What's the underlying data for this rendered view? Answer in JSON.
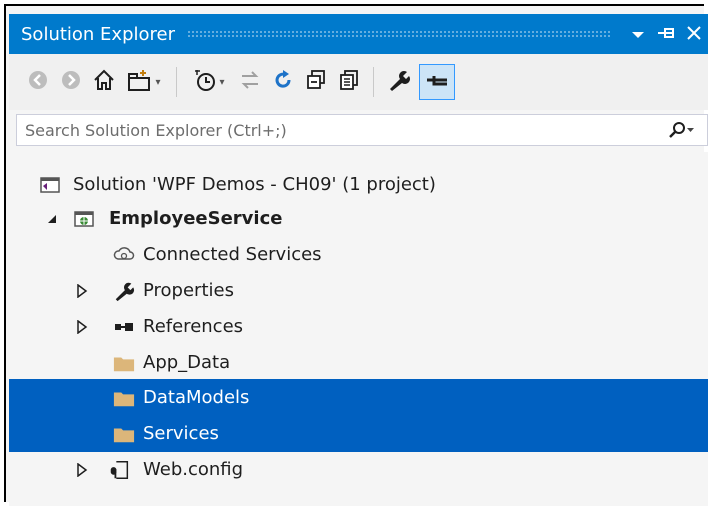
{
  "window": {
    "title": "Solution Explorer",
    "controls": {
      "dropdown": "▾",
      "pin": "⊣",
      "close": "✕"
    }
  },
  "toolbar": {
    "buttons": [
      "back-icon",
      "forward-icon",
      "home-icon",
      "switch-views-icon",
      "pending-changes-icon",
      "sync-icon",
      "refresh-icon",
      "collapse-all-icon",
      "show-all-files-icon",
      "properties-icon",
      "preview-selected-icon"
    ]
  },
  "search": {
    "placeholder": "Search Solution Explorer (Ctrl+;)"
  },
  "tree": {
    "solution": "Solution 'WPF Demos - CH09' (1 project)",
    "project": "EmployeeService",
    "items": [
      {
        "label": "Connected Services",
        "icon": "connected-services-icon"
      },
      {
        "label": "Properties",
        "icon": "wrench-icon"
      },
      {
        "label": "References",
        "icon": "references-icon"
      },
      {
        "label": "App_Data",
        "icon": "folder-icon"
      },
      {
        "label": "DataModels",
        "icon": "folder-icon",
        "selected": true
      },
      {
        "label": "Services",
        "icon": "folder-icon",
        "selected": true
      },
      {
        "label": "Web.config",
        "icon": "config-file-icon"
      }
    ]
  },
  "colors": {
    "accent": "#007acc",
    "selection": "#0060c0",
    "folder": "#dcb67a"
  }
}
